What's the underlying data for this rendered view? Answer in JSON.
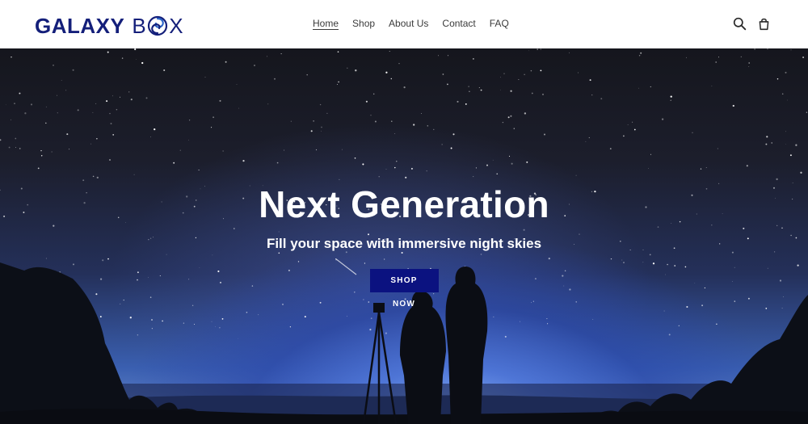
{
  "brand": {
    "name_part1": "GALAXY",
    "name_part2_prefix": "B",
    "name_part2_suffix": "X",
    "color": "#141f7a"
  },
  "nav": {
    "items": [
      {
        "label": "Home",
        "active": true
      },
      {
        "label": "Shop",
        "active": false
      },
      {
        "label": "About Us",
        "active": false
      },
      {
        "label": "Contact",
        "active": false
      },
      {
        "label": "FAQ",
        "active": false
      }
    ]
  },
  "header_icons": [
    "search-icon",
    "cart-icon"
  ],
  "hero": {
    "title": "Next Generation",
    "subtitle": "Fill your space with immersive night skies",
    "cta_label": "SHOP NOW",
    "cta_color": "#0b1280"
  }
}
